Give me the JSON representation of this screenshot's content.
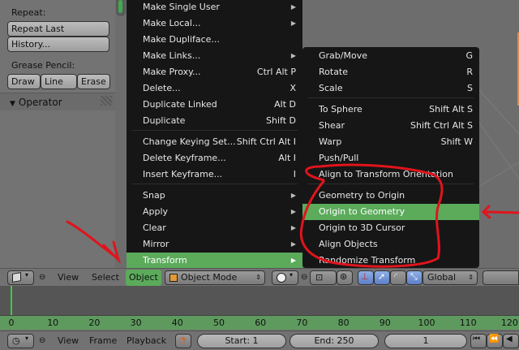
{
  "tool_panel": {
    "repeat_title": "Repeat:",
    "repeat_last": "Repeat Last",
    "history": "History...",
    "grease_title": "Grease Pencil:",
    "grease_draw": "Draw",
    "grease_line": "Line",
    "grease_erase": "Erase",
    "operator": "Operator"
  },
  "object_menu": [
    {
      "label": "Make Single User",
      "shortcut": "",
      "submenu": true
    },
    {
      "label": "Make Local...",
      "shortcut": "",
      "submenu": true
    },
    {
      "label": "Make Dupliface...",
      "shortcut": "",
      "submenu": false
    },
    {
      "label": "Make Links...",
      "shortcut": "",
      "submenu": true
    },
    {
      "label": "Make Proxy...",
      "shortcut": "Ctrl Alt P",
      "submenu": false
    },
    {
      "label": "Delete...",
      "shortcut": "X",
      "submenu": false
    },
    {
      "label": "Duplicate Linked",
      "shortcut": "Alt D",
      "submenu": false
    },
    {
      "label": "Duplicate",
      "shortcut": "Shift D",
      "submenu": false
    },
    {
      "label": "Change Keying Set...",
      "shortcut": "Shift Ctrl Alt I",
      "submenu": false
    },
    {
      "label": "Delete Keyframe...",
      "shortcut": "Alt I",
      "submenu": false
    },
    {
      "label": "Insert Keyframe...",
      "shortcut": "I",
      "submenu": false
    },
    {
      "label": "Snap",
      "shortcut": "",
      "submenu": true
    },
    {
      "label": "Apply",
      "shortcut": "",
      "submenu": true
    },
    {
      "label": "Clear",
      "shortcut": "",
      "submenu": true
    },
    {
      "label": "Mirror",
      "shortcut": "",
      "submenu": true
    },
    {
      "label": "Transform",
      "shortcut": "",
      "submenu": true,
      "active": true
    }
  ],
  "transform_menu": [
    {
      "label": "Grab/Move",
      "shortcut": "G"
    },
    {
      "label": "Rotate",
      "shortcut": "R"
    },
    {
      "label": "Scale",
      "shortcut": "S"
    },
    {
      "label": "To Sphere",
      "shortcut": "Shift Alt S"
    },
    {
      "label": "Shear",
      "shortcut": "Shift Ctrl Alt S"
    },
    {
      "label": "Warp",
      "shortcut": "Shift W"
    },
    {
      "label": "Push/Pull",
      "shortcut": ""
    },
    {
      "label": "Align to Transform Orientation",
      "shortcut": ""
    },
    {
      "label": "Geometry to Origin",
      "shortcut": ""
    },
    {
      "label": "Origin to Geometry",
      "shortcut": "",
      "active": true
    },
    {
      "label": "Origin to 3D Cursor",
      "shortcut": ""
    },
    {
      "label": "Align Objects",
      "shortcut": ""
    },
    {
      "label": "Randomize Transform",
      "shortcut": ""
    }
  ],
  "header": {
    "view": "View",
    "select": "Select",
    "object": "Object",
    "mode": "Object Mode",
    "orientation": "Global"
  },
  "timeline": {
    "ticks": [
      "0",
      "10",
      "20",
      "30",
      "40",
      "50",
      "60",
      "70",
      "80",
      "90",
      "100",
      "110",
      "120"
    ]
  },
  "bottom": {
    "view": "View",
    "frame": "Frame",
    "playback": "Playback",
    "start": "Start: 1",
    "end": "End: 250",
    "current": "1"
  },
  "colors": {
    "menu_bg": "#161616",
    "highlight": "#5bab5b",
    "annotation": "#e0141c",
    "timeline_ruler": "#5e9a5e"
  }
}
